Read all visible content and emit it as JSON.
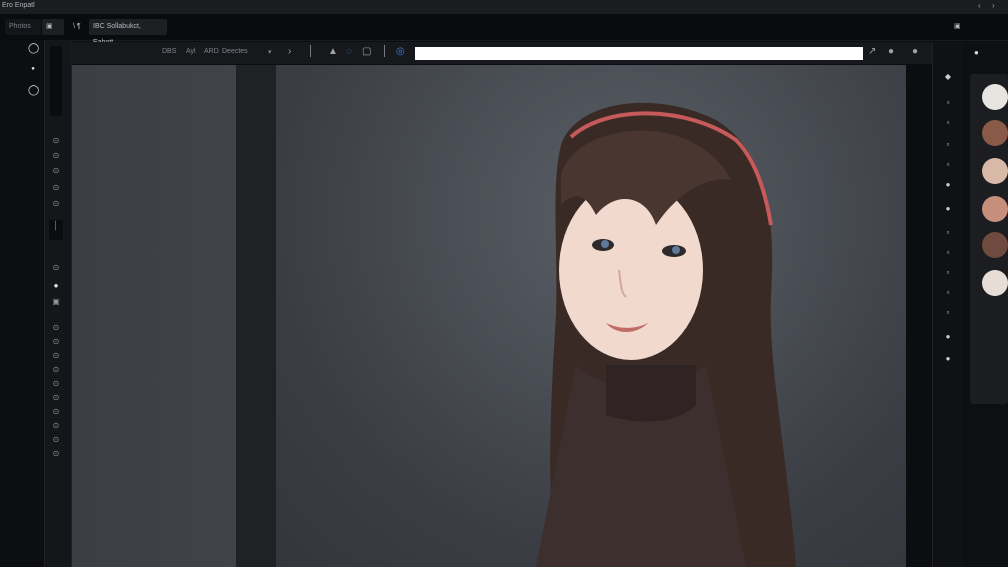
{
  "window": {
    "title": "Ero Enpatl",
    "controls": [
      "‹",
      "›"
    ]
  },
  "tabs": [
    {
      "label": "Photos"
    },
    {
      "label": "\\ ¶"
    },
    {
      "label": "IBC  Sollabukct, Eabott"
    }
  ],
  "options_bar": {
    "items": [
      "DBS",
      "Ayl",
      "ARD",
      "Deectes"
    ],
    "tools": [
      "›",
      "│",
      "▲",
      "◌",
      "▢",
      "│",
      "◎"
    ],
    "url_value": "",
    "right_icons": [
      "↗",
      "●"
    ]
  },
  "left_panel": {
    "icons": [
      "◯",
      "●",
      "◯"
    ]
  },
  "toolstrip": {
    "slots": [
      "⊙",
      "⊙",
      "⊙",
      "⊙",
      "⊙",
      "│",
      "⊙",
      "●",
      "▣",
      "⊙",
      "⊙",
      "⊙",
      "⊙",
      "⊙",
      "⊙",
      "⊙",
      "⊙",
      "⊙",
      "⊙"
    ]
  },
  "right_rail": {
    "slots": [
      "◆",
      "▫",
      "▫",
      "▫",
      "▫",
      "●",
      "●",
      "▫",
      "▫",
      "▫",
      "▫",
      "▫",
      "●",
      "●"
    ]
  },
  "swatches": [
    {
      "name": "swatch-light-1",
      "color": "#e8e4e0"
    },
    {
      "name": "swatch-portrait-1",
      "color": "#8a5a48"
    },
    {
      "name": "swatch-skin-1",
      "color": "#d8b8a6"
    },
    {
      "name": "swatch-skin-2",
      "color": "#c58f7c"
    },
    {
      "name": "swatch-portrait-2",
      "color": "#6e4a3f"
    },
    {
      "name": "swatch-light-2",
      "color": "#e5ddd6"
    }
  ],
  "colors": {
    "accent": "#3b82f6",
    "canvas_bg": "#3b3e43",
    "app_bg": "#0c0d10"
  },
  "document": {
    "image_description": "portrait photo on dark gray background"
  }
}
